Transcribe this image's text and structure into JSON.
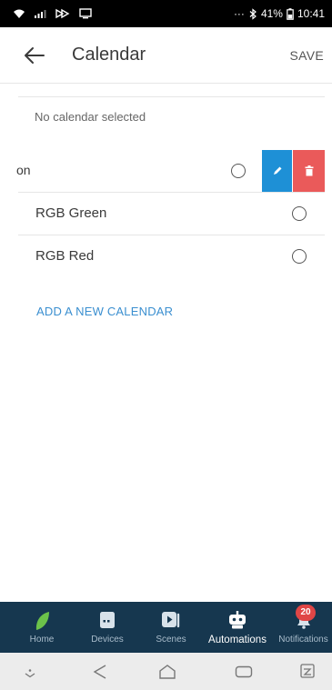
{
  "statusbar": {
    "battery": "41%",
    "time": "10:41",
    "more": "···"
  },
  "header": {
    "title": "Calendar",
    "save_label": "SAVE"
  },
  "content": {
    "no_calendar_text": "No calendar selected",
    "swiped_item_label": "on",
    "items": [
      {
        "label": "RGB Green"
      },
      {
        "label": "RGB Red"
      }
    ],
    "add_label": "ADD A NEW CALENDAR"
  },
  "bottomnav": {
    "items": [
      {
        "label": "Home"
      },
      {
        "label": "Devices"
      },
      {
        "label": "Scenes"
      },
      {
        "label": "Automations"
      },
      {
        "label": "Notifications"
      }
    ],
    "notifications_badge": "20"
  },
  "colors": {
    "edit_action": "#1e90d6",
    "delete_action": "#ea5a5a",
    "nav_background": "#16374f",
    "link": "#3b8fd0",
    "leaf": "#6cc24a"
  },
  "icons": {
    "back": "arrow-left-icon",
    "edit": "pencil-icon",
    "delete": "trash-icon",
    "home": "leaf-icon",
    "devices": "device-icon",
    "scenes": "scenes-icon",
    "automations": "robot-icon",
    "notifications": "bell-icon"
  }
}
